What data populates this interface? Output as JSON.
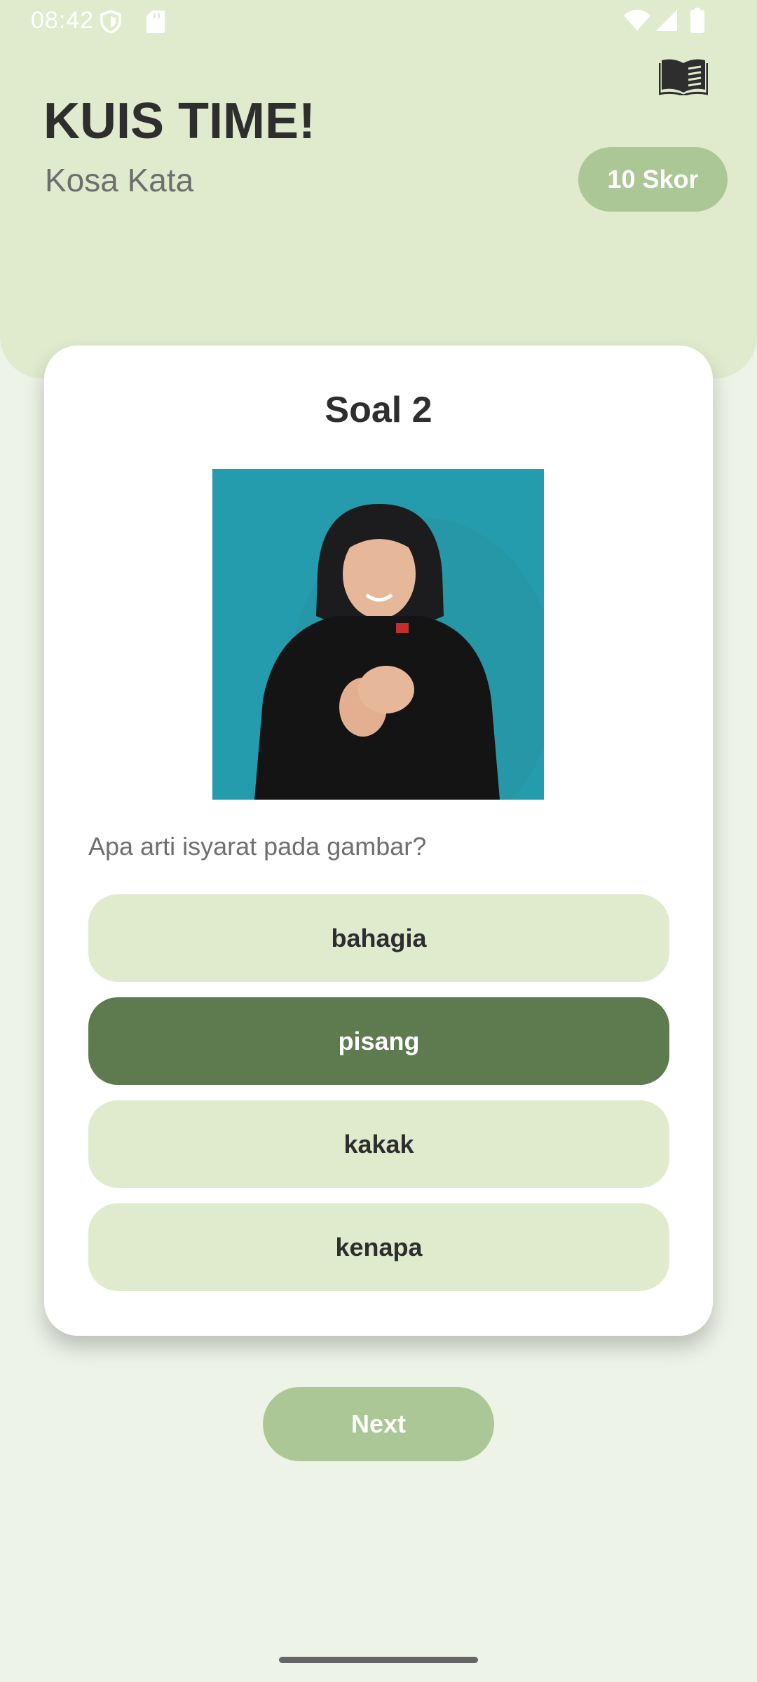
{
  "status_bar": {
    "time": "08:42",
    "icons": [
      "shield-icon",
      "sd-card-icon",
      "wifi-icon",
      "signal-icon",
      "battery-icon"
    ]
  },
  "header": {
    "title": "KUIS TIME!",
    "subtitle": "Kosa Kata",
    "score": "10 Skor",
    "book_icon": "book-icon"
  },
  "quiz": {
    "question_number": "Soal 2",
    "prompt": "Apa arti isyarat pada gambar?",
    "options": [
      {
        "label": "bahagia",
        "selected": false
      },
      {
        "label": "pisang",
        "selected": true
      },
      {
        "label": "kakak",
        "selected": false
      },
      {
        "label": "kenapa",
        "selected": false
      }
    ]
  },
  "footer": {
    "next_label": "Next"
  },
  "colors": {
    "header_bg": "#E0EBCE",
    "page_bg": "#EEF3E8",
    "accent": "#ABC796",
    "selected": "#5E7B50",
    "image_bg": "#259CAD"
  }
}
